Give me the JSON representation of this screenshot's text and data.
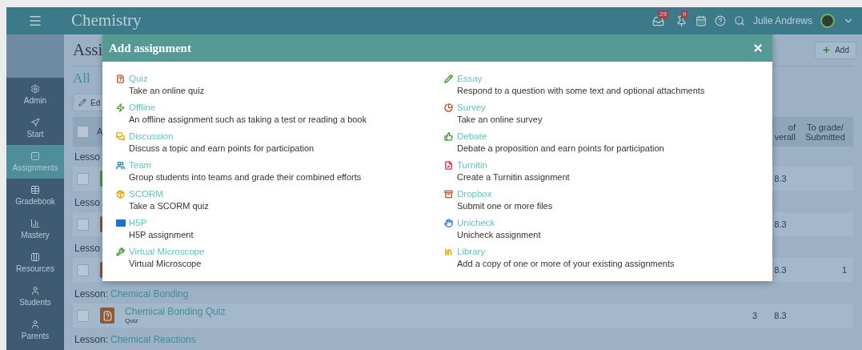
{
  "top_bar": {
    "title": "Chemistry",
    "inbox_badge": "29",
    "alerts_badge": "9",
    "user_name": "Julie Andrews"
  },
  "sidebar": {
    "items": [
      {
        "label": "Admin",
        "selected": false
      },
      {
        "label": "Start",
        "selected": false
      },
      {
        "label": "Assignments",
        "selected": true
      },
      {
        "label": "Gradebook",
        "selected": false
      },
      {
        "label": "Mastery",
        "selected": false
      },
      {
        "label": "Resources",
        "selected": false
      },
      {
        "label": "Students",
        "selected": false
      },
      {
        "label": "Parents",
        "selected": false
      }
    ]
  },
  "main": {
    "title": "Assi",
    "add_button": "Add",
    "filter_link": "All",
    "edit_button": "Ed",
    "table": {
      "header": {
        "checked": false,
        "column_1": "A",
        "column_score": [
          "of",
          "verall"
        ],
        "column_submitted": [
          "To grade/",
          "Submitted"
        ]
      },
      "rows": [
        {
          "kind": "lesson",
          "label": "Lesso"
        },
        {
          "kind": "item",
          "checked": false,
          "color": "#4a9a3a",
          "score": "8.3"
        },
        {
          "kind": "lesson",
          "label": "Lesso"
        },
        {
          "kind": "item",
          "checked": false,
          "color": "#8a5a3a",
          "score": "8.3"
        },
        {
          "kind": "lesson",
          "label": "Lesso"
        },
        {
          "kind": "item",
          "checked": false,
          "color": "#8a5a3a",
          "score": "8.3",
          "submitted": "1"
        },
        {
          "kind": "lesson",
          "label": "Lesson:",
          "link": "Chemical Bonding"
        },
        {
          "kind": "item",
          "checked": false,
          "color": "#8a5a3a",
          "title": "Chemical Bonding Quiz",
          "subtitle": "Quiz",
          "points": "3",
          "score": "8.3"
        },
        {
          "kind": "lesson",
          "label": "Lesson:",
          "link": "Chemical Reactions"
        }
      ]
    }
  },
  "dialog": {
    "title": "Add assignment",
    "columns": [
      [
        {
          "name": "Quiz",
          "description": "Take an online quiz"
        },
        {
          "name": "Offline",
          "description": "An offline assignment such as taking a test or reading a book"
        },
        {
          "name": "Discussion",
          "description": "Discuss a topic and earn points for participation"
        },
        {
          "name": "Team",
          "description": "Group students into teams and grade their combined efforts"
        },
        {
          "name": "SCORM",
          "description": "Take a SCORM quiz"
        },
        {
          "name": "H5P",
          "description": "H5P assignment"
        },
        {
          "name": "Virtual Microscope",
          "description": "Virtual Microscope"
        }
      ],
      [
        {
          "name": "Essay",
          "description": "Respond to a question with some text and optional attachments"
        },
        {
          "name": "Survey",
          "description": "Take an online survey"
        },
        {
          "name": "Debate",
          "description": "Debate a proposition and earn points for participation"
        },
        {
          "name": "Turnitin",
          "description": "Create a Turnitin assignment"
        },
        {
          "name": "Dropbox",
          "description": "Submit one or more files"
        },
        {
          "name": "Unicheck",
          "description": "Unicheck assignment"
        },
        {
          "name": "Library",
          "description": "Add a copy of one or more of your existing assignments"
        }
      ]
    ]
  }
}
